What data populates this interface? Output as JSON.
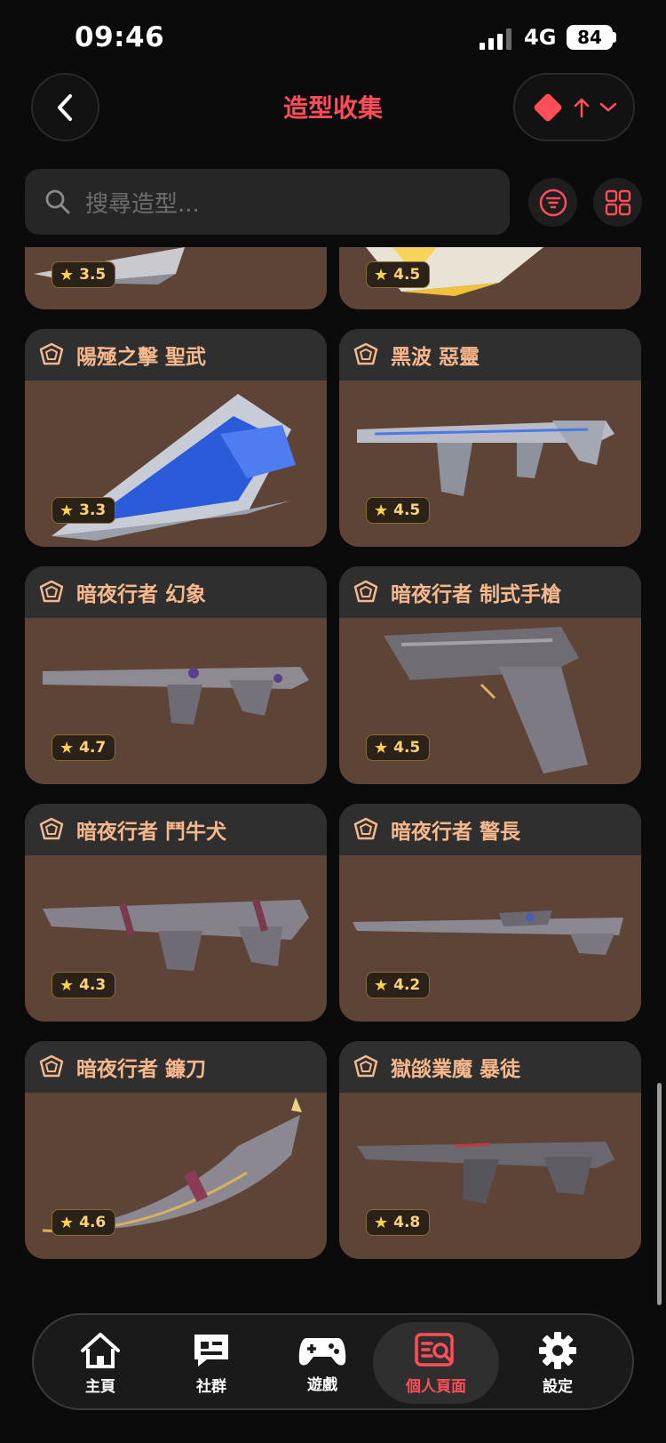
{
  "status": {
    "time": "09:46",
    "network": "4G",
    "battery": "84"
  },
  "header": {
    "title": "造型收集"
  },
  "search": {
    "placeholder": "搜尋造型..."
  },
  "colors": {
    "accent": "#ff4e58",
    "card_title": "#f6b88c",
    "card_bg": "#5e4436",
    "card_head": "#2f2f2f",
    "rating": "#ffd27a"
  },
  "cards_partial": [
    {
      "rating": "3.5",
      "icon": "silver-blade"
    },
    {
      "rating": "4.5",
      "icon": "gold-block"
    }
  ],
  "cards": [
    {
      "name": "陽殛之擊 聖武",
      "rating": "3.3",
      "icon": "blue-crystal-blade"
    },
    {
      "name": "黑波 惡靈",
      "rating": "4.5",
      "icon": "silver-smg"
    },
    {
      "name": "暗夜行者 幻象",
      "rating": "4.7",
      "icon": "dark-rifle"
    },
    {
      "name": "暗夜行者 制式手槍",
      "rating": "4.5",
      "icon": "dark-pistol"
    },
    {
      "name": "暗夜行者 鬥牛犬",
      "rating": "4.3",
      "icon": "dark-bulldog"
    },
    {
      "name": "暗夜行者 警長",
      "rating": "4.2",
      "icon": "dark-sniper"
    },
    {
      "name": "暗夜行者 鐮刀",
      "rating": "4.6",
      "icon": "dark-knife"
    },
    {
      "name": "獄燄業魔 暴徒",
      "rating": "4.8",
      "icon": "dark-vandal"
    }
  ],
  "tabs": [
    {
      "label": "主頁",
      "icon": "home-icon"
    },
    {
      "label": "社群",
      "icon": "chat-icon"
    },
    {
      "label": "遊戲",
      "icon": "gamepad-icon"
    },
    {
      "label": "個人頁面",
      "icon": "profile-search-icon",
      "active": true
    },
    {
      "label": "設定",
      "icon": "gear-icon"
    }
  ]
}
